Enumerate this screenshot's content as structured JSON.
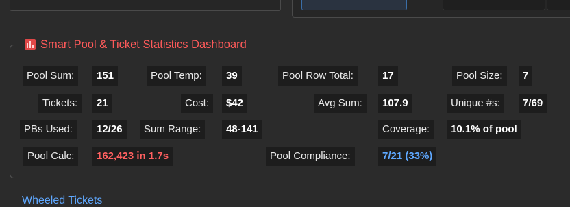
{
  "section": {
    "title": "Smart Pool & Ticket Statistics Dashboard",
    "icon": "bar-chart-icon"
  },
  "stats": {
    "pool_sum_label": "Pool Sum:",
    "pool_sum": "151",
    "pool_temp_label": "Pool Temp:",
    "pool_temp": "39",
    "pool_row_total_label": "Pool Row Total:",
    "pool_row_total": "17",
    "pool_size_label": "Pool Size:",
    "pool_size": "7",
    "tickets_label": "Tickets:",
    "tickets": "21",
    "cost_label": "Cost:",
    "cost": "$42",
    "avg_sum_label": "Avg Sum:",
    "avg_sum": "107.9",
    "unique_label": "Unique #s:",
    "unique": "7/69",
    "pbs_used_label": "PBs Used:",
    "pbs_used": "12/26",
    "sum_range_label": "Sum Range:",
    "sum_range": "48-141",
    "coverage_label": "Coverage:",
    "coverage": "10.1% of pool",
    "pool_calc_label": "Pool Calc:",
    "pool_calc": "162,423 in 1.7s",
    "pool_compliance_label": "Pool Compliance:",
    "pool_compliance": "7/21 (33%)"
  },
  "next_section": {
    "title": "Wheeled Tickets"
  },
  "colors": {
    "accent_red": "#ff5a5a",
    "accent_blue": "#5fa8ff"
  }
}
